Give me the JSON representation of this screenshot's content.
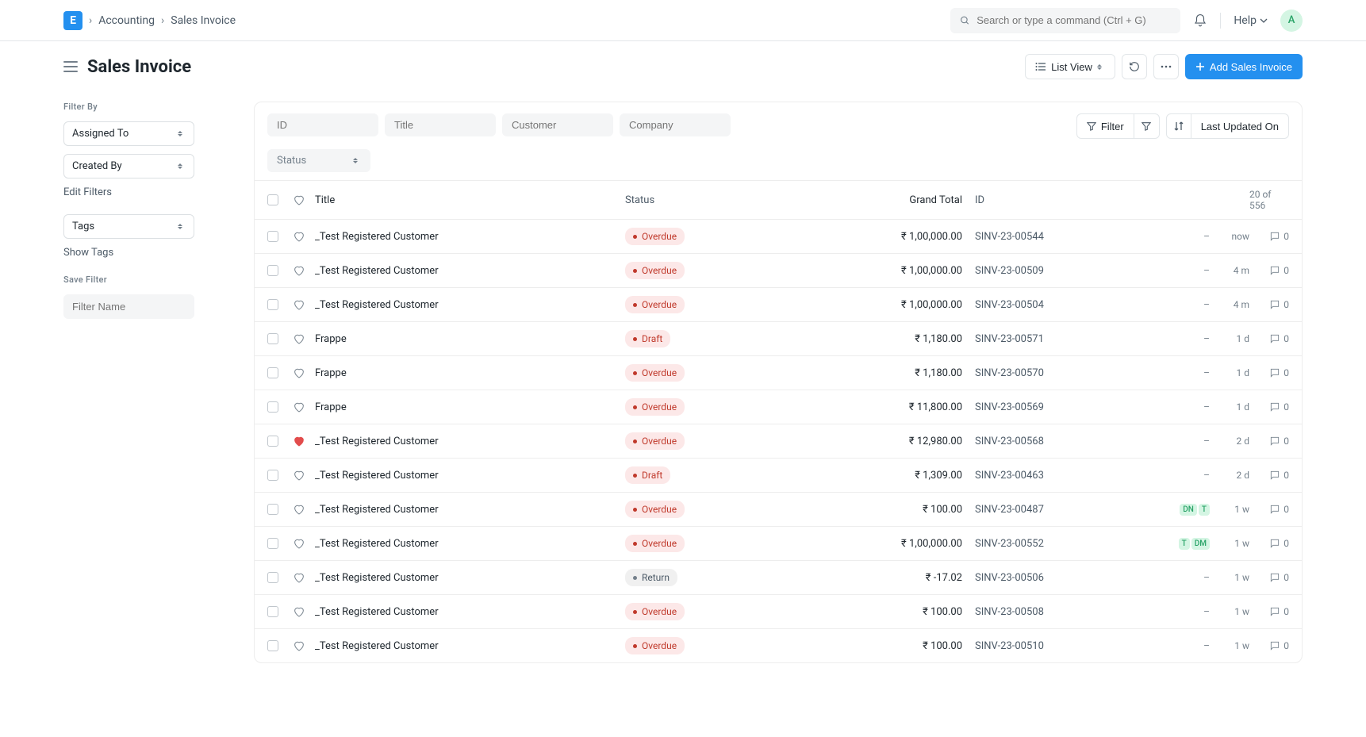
{
  "header": {
    "logo_letter": "E",
    "breadcrumbs": [
      "Accounting",
      "Sales Invoice"
    ],
    "search_placeholder": "Search or type a command (Ctrl + G)",
    "help_label": "Help",
    "avatar_letter": "A"
  },
  "page": {
    "title": "Sales Invoice",
    "view_label": "List View",
    "add_button": "Add Sales Invoice"
  },
  "sidebar": {
    "filter_by_label": "Filter By",
    "assigned_to": "Assigned To",
    "created_by": "Created By",
    "edit_filters": "Edit Filters",
    "tags": "Tags",
    "show_tags": "Show Tags",
    "save_filter_label": "Save Filter",
    "filter_name_placeholder": "Filter Name"
  },
  "toolbar": {
    "id_placeholder": "ID",
    "title_placeholder": "Title",
    "customer_placeholder": "Customer",
    "company_placeholder": "Company",
    "status_placeholder": "Status",
    "filter_label": "Filter",
    "sort_label": "Last Updated On"
  },
  "list": {
    "head": {
      "title": "Title",
      "status": "Status",
      "grand_total": "Grand Total",
      "id": "ID",
      "count": "20 of 556"
    },
    "rows": [
      {
        "title": "_Test Registered Customer",
        "status": "Overdue",
        "status_kind": "overdue",
        "grand_total": "₹ 1,00,000.00",
        "id": "SINV-23-00544",
        "assign": "–",
        "time": "now",
        "comments": "0",
        "liked": false
      },
      {
        "title": "_Test Registered Customer",
        "status": "Overdue",
        "status_kind": "overdue",
        "grand_total": "₹ 1,00,000.00",
        "id": "SINV-23-00509",
        "assign": "–",
        "time": "4 m",
        "comments": "0",
        "liked": false
      },
      {
        "title": "_Test Registered Customer",
        "status": "Overdue",
        "status_kind": "overdue",
        "grand_total": "₹ 1,00,000.00",
        "id": "SINV-23-00504",
        "assign": "–",
        "time": "4 m",
        "comments": "0",
        "liked": false
      },
      {
        "title": "Frappe",
        "status": "Draft",
        "status_kind": "draft",
        "grand_total": "₹ 1,180.00",
        "id": "SINV-23-00571",
        "assign": "–",
        "time": "1 d",
        "comments": "0",
        "liked": false
      },
      {
        "title": "Frappe",
        "status": "Overdue",
        "status_kind": "overdue",
        "grand_total": "₹ 1,180.00",
        "id": "SINV-23-00570",
        "assign": "–",
        "time": "1 d",
        "comments": "0",
        "liked": false
      },
      {
        "title": "Frappe",
        "status": "Overdue",
        "status_kind": "overdue",
        "grand_total": "₹ 11,800.00",
        "id": "SINV-23-00569",
        "assign": "–",
        "time": "1 d",
        "comments": "0",
        "liked": false
      },
      {
        "title": "_Test Registered Customer",
        "status": "Overdue",
        "status_kind": "overdue",
        "grand_total": "₹ 12,980.00",
        "id": "SINV-23-00568",
        "assign": "–",
        "time": "2 d",
        "comments": "0",
        "liked": true
      },
      {
        "title": "_Test Registered Customer",
        "status": "Draft",
        "status_kind": "draft",
        "grand_total": "₹ 1,309.00",
        "id": "SINV-23-00463",
        "assign": "–",
        "time": "2 d",
        "comments": "0",
        "liked": false
      },
      {
        "title": "_Test Registered Customer",
        "status": "Overdue",
        "status_kind": "overdue",
        "grand_total": "₹ 100.00",
        "id": "SINV-23-00487",
        "assign_badges": [
          "DN",
          "T"
        ],
        "time": "1 w",
        "comments": "0",
        "liked": false
      },
      {
        "title": "_Test Registered Customer",
        "status": "Overdue",
        "status_kind": "overdue",
        "grand_total": "₹ 1,00,000.00",
        "id": "SINV-23-00552",
        "assign_badges": [
          "T",
          "DM"
        ],
        "time": "1 w",
        "comments": "0",
        "liked": false
      },
      {
        "title": "_Test Registered Customer",
        "status": "Return",
        "status_kind": "return",
        "grand_total": "₹ -17.02",
        "id": "SINV-23-00506",
        "assign": "–",
        "time": "1 w",
        "comments": "0",
        "liked": false
      },
      {
        "title": "_Test Registered Customer",
        "status": "Overdue",
        "status_kind": "overdue",
        "grand_total": "₹ 100.00",
        "id": "SINV-23-00508",
        "assign": "–",
        "time": "1 w",
        "comments": "0",
        "liked": false
      },
      {
        "title": "_Test Registered Customer",
        "status": "Overdue",
        "status_kind": "overdue",
        "grand_total": "₹ 100.00",
        "id": "SINV-23-00510",
        "assign": "–",
        "time": "1 w",
        "comments": "0",
        "liked": false
      }
    ]
  }
}
